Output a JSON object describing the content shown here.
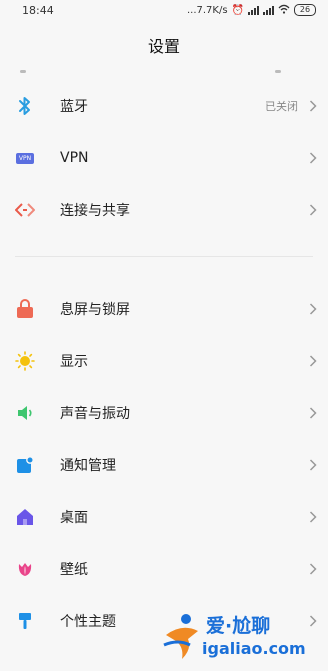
{
  "status_bar": {
    "time": "18:44",
    "net_speed": "...7.7K/s",
    "battery": "26"
  },
  "header": {
    "title": "设置"
  },
  "group1": [
    {
      "label": "蓝牙",
      "value": "已关闭",
      "icon": "bluetooth-icon"
    },
    {
      "label": "VPN",
      "icon": "vpn-icon"
    },
    {
      "label": "连接与共享",
      "icon": "share-icon"
    }
  ],
  "group2": [
    {
      "label": "息屏与锁屏",
      "icon": "lock-icon"
    },
    {
      "label": "显示",
      "icon": "sun-icon"
    },
    {
      "label": "声音与振动",
      "icon": "speaker-icon"
    },
    {
      "label": "通知管理",
      "icon": "notification-icon"
    },
    {
      "label": "桌面",
      "icon": "home-icon"
    },
    {
      "label": "壁纸",
      "icon": "tulip-icon"
    },
    {
      "label": "个性主题",
      "icon": "brush-icon"
    }
  ],
  "vpn_badge": "VPN",
  "watermark": {
    "line1": "爱·尬聊",
    "line2": "igaliao.com"
  },
  "colors": {
    "bluetooth": "#2a9de0",
    "vpn": "#5b6fe0",
    "share": "#ea5a4a",
    "lock": "#ee6a55",
    "sun": "#f4c20d",
    "sound": "#3ec66f",
    "notify": "#1e90e6",
    "home": "#6a56e8",
    "tulip": "#e9448a",
    "brush": "#1e90e6",
    "watermark": "#1a6fd8"
  }
}
